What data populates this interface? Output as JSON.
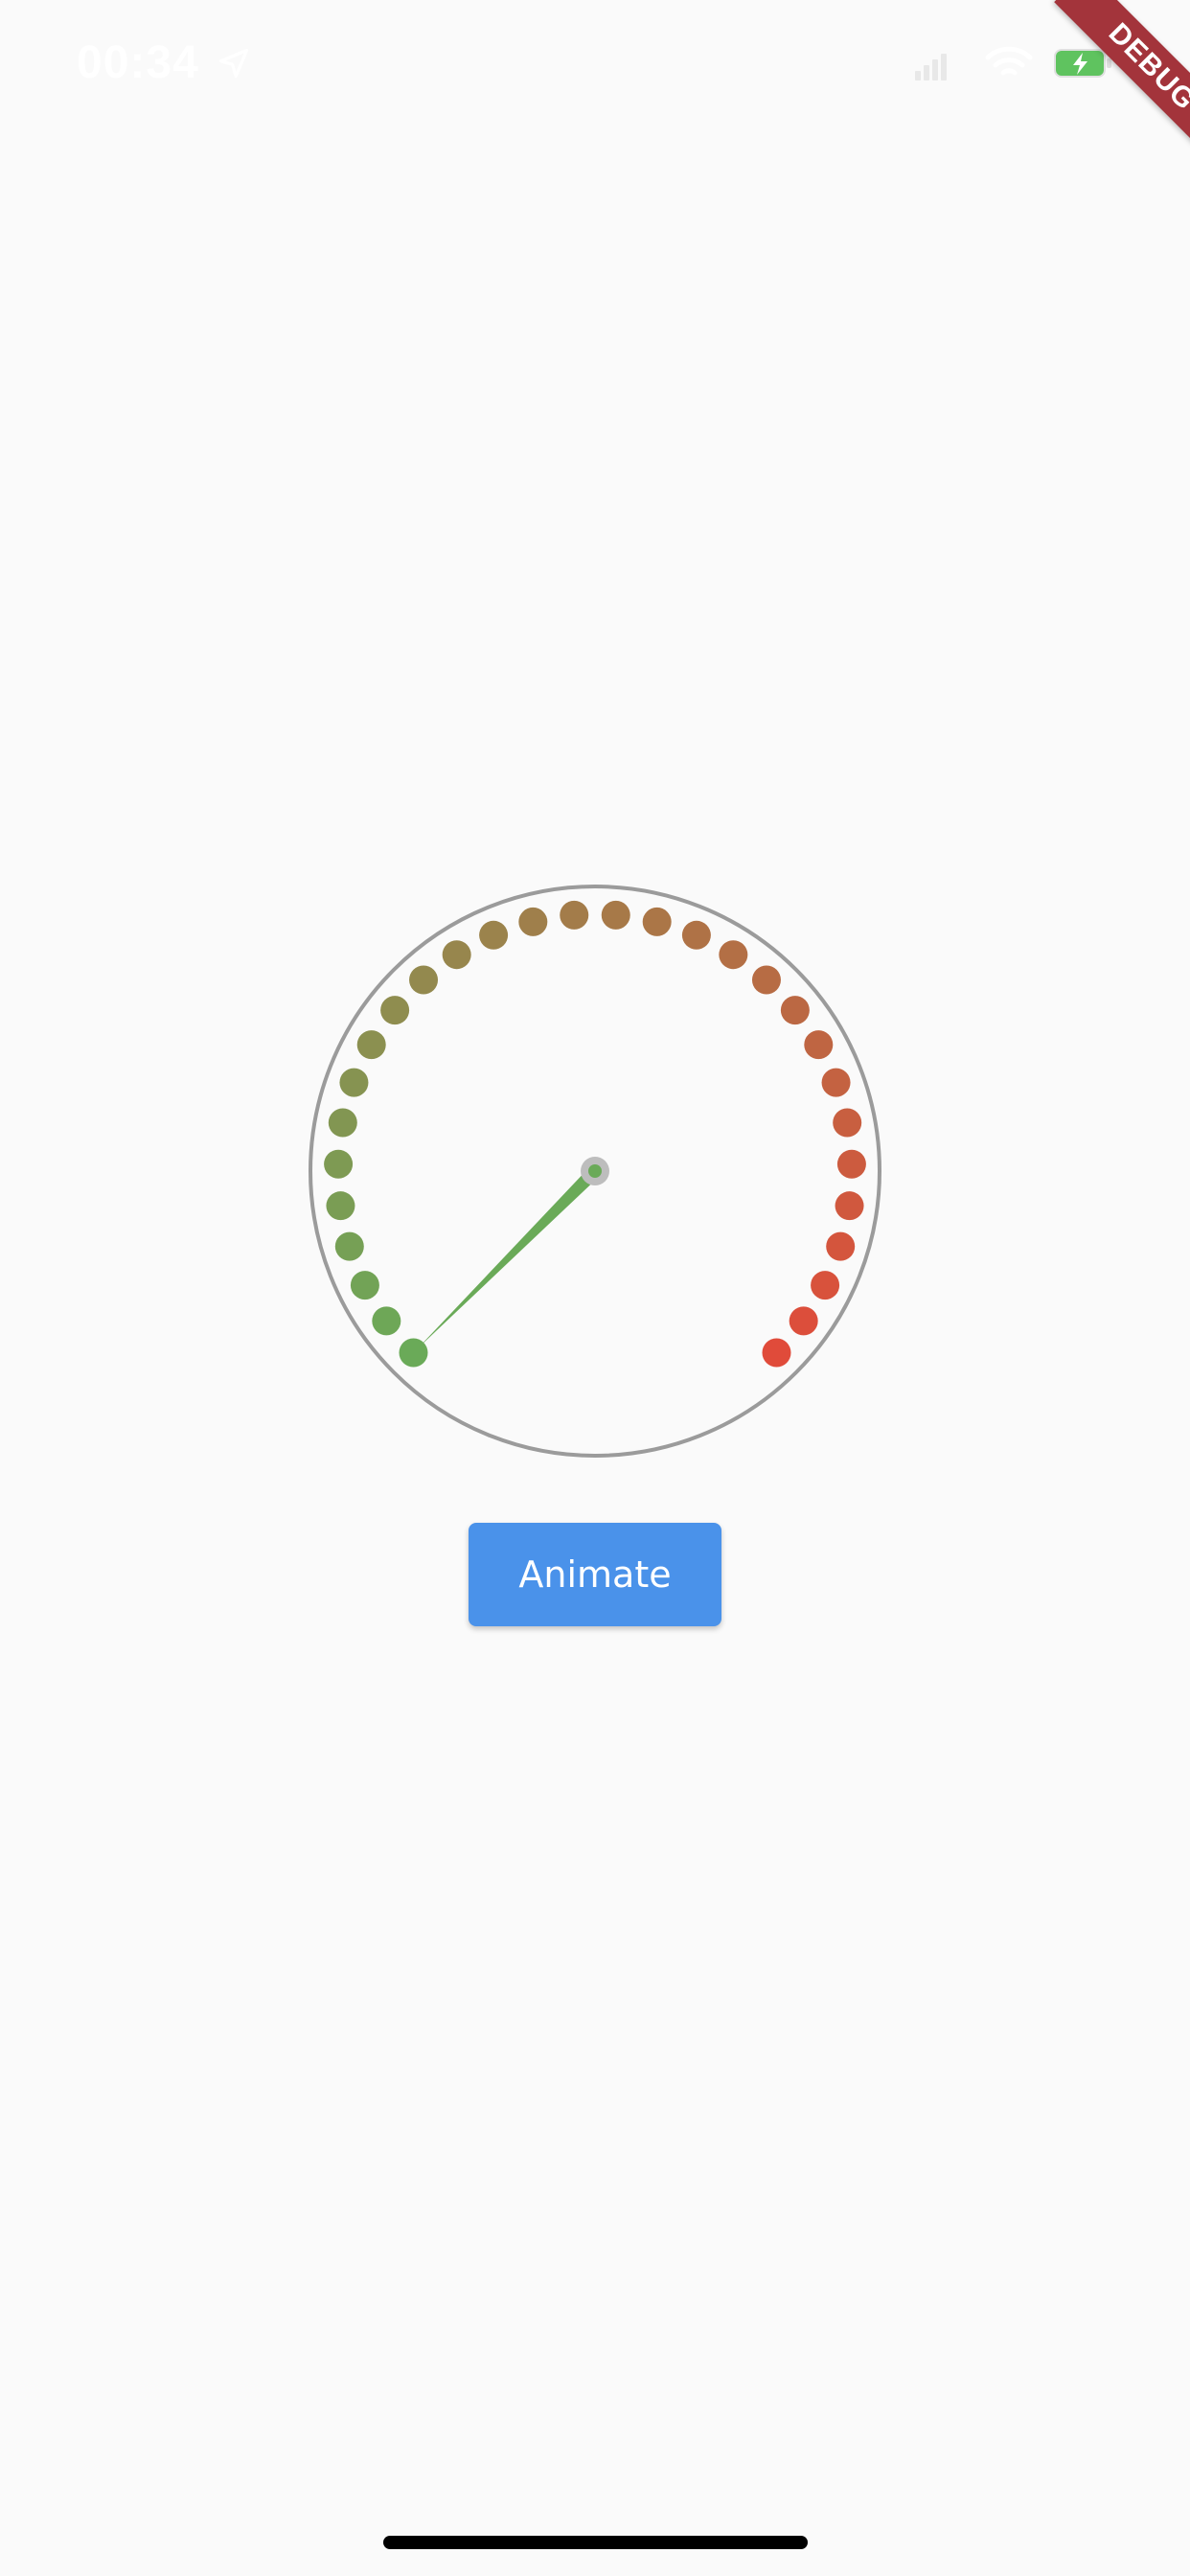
{
  "status_bar": {
    "time": "00:34",
    "battery_color": "#5fc35f"
  },
  "debug_banner": {
    "label": "DEBUG",
    "color": "#a3343b"
  },
  "gauge": {
    "value_fraction": 0.0,
    "dot_count": 30,
    "start_color": "#6aaa58",
    "end_color": "#e04b3a",
    "ring_color": "#9b9b9b",
    "needle_color": "#6aaa58",
    "hub_color": "#bdbdbd"
  },
  "button": {
    "label": "Animate",
    "color": "#4a92ea"
  }
}
